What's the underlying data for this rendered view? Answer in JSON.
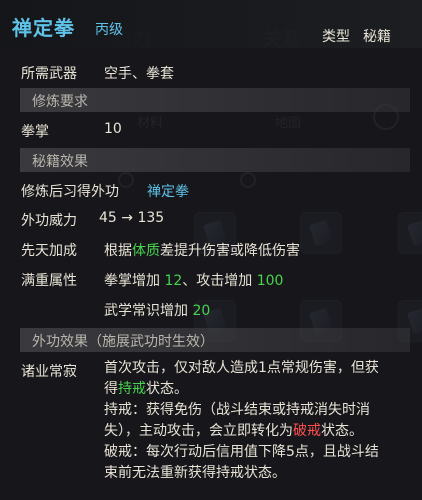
{
  "background": {
    "tabs": [
      "能力",
      "关系"
    ],
    "row2": [
      "材料",
      "地图"
    ]
  },
  "header": {
    "title": "禅定拳",
    "grade": "丙级",
    "type_label": "类型",
    "type_value": "秘籍"
  },
  "weapon": {
    "label": "所需武器",
    "value": "空手、拳套"
  },
  "training": {
    "section_title": "修炼要求",
    "skill_label": "拳掌",
    "skill_value": "10"
  },
  "effects": {
    "section_title": "秘籍效果",
    "learn_label": "修炼后习得外功",
    "learn_value": "禅定拳",
    "power_label": "外功威力",
    "power_value": "45 → 135",
    "bonus_label": "先天加成",
    "bonus_pre": "根据",
    "bonus_attr": "体质",
    "bonus_post": "差提升伤害或降低伤害",
    "full_label": "满重属性",
    "full_line1_a": "拳掌增加 ",
    "full_line1_b": "12",
    "full_line1_c": "、攻击增加 ",
    "full_line1_d": "100",
    "full_line2_a": "武学常识增加 ",
    "full_line2_b": "20"
  },
  "external": {
    "section_title": "外功效果（施展武功时生效）",
    "skill_label": "诸业常寂",
    "l1": "首次攻击，仅对敌人造成1点常规伤害，但获",
    "l2_a": "得",
    "l2_b": "持戒",
    "l2_c": "状态。",
    "l3": "持戒：获得免伤（战斗结束或持戒消失时消",
    "l4_a": "失），主动攻击，会立即转化为",
    "l4_b": "破戒",
    "l4_c": "状态。",
    "l5": "破戒：每次行动后信用值下降5点，且战斗结",
    "l6": "束前无法重新获得持戒状态。"
  }
}
